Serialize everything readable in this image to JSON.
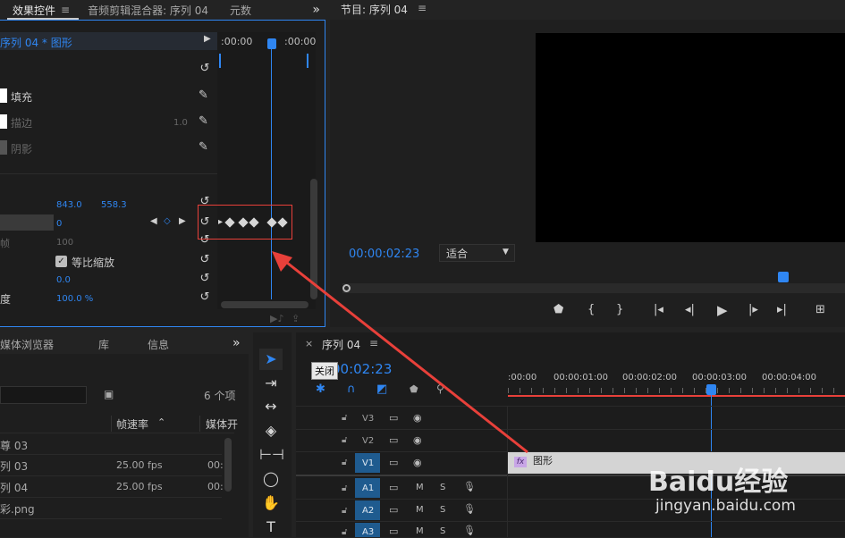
{
  "effect_controls": {
    "tabs": [
      "效果控件",
      "音频剪辑混合器: 序列 04",
      "元数"
    ],
    "overflow": "»",
    "menu_icon": "≡",
    "clip_path": "序列 04 * 图形",
    "timeline_start": ":00:00",
    "timeline_end": ":00:00",
    "appearance": {
      "fill_label": "填充",
      "stroke_label": "描边",
      "stroke_value": "1.0",
      "shadow_label": "阴影"
    },
    "position": {
      "x": "843.0",
      "y": "558.3"
    },
    "scale_value": "0",
    "scale_width_label": "帧",
    "scale_width_value": "100",
    "uniform_scale_label": "等比缩放",
    "rotation_value": "0.0",
    "opacity_label": "度",
    "opacity_value": "100.0 %"
  },
  "program": {
    "title": "节目: 序列 04",
    "menu_icon": "≡",
    "timecode": "00:00:02:23",
    "fit_label": "适合"
  },
  "project": {
    "tabs": [
      "媒体浏览器",
      "库",
      "信息"
    ],
    "overflow": "»",
    "item_count": "6 个项",
    "columns": [
      "帧速率",
      "媒体开"
    ],
    "rows": [
      {
        "name": "尊 03",
        "fps": "",
        "start": ""
      },
      {
        "name": "列 03",
        "fps": "25.00 fps",
        "start": "00:"
      },
      {
        "name": "列 04",
        "fps": "25.00 fps",
        "start": "00:"
      },
      {
        "name": "彩.png",
        "fps": "",
        "start": ""
      }
    ]
  },
  "timeline": {
    "close": "×",
    "sequence_name": "序列 04",
    "menu_icon": "≡",
    "timecode": "00:02:23",
    "tooltip": "关闭",
    "ruler": [
      ":00:00",
      "00:00:01:00",
      "00:00:02:00",
      "00:00:03:00",
      "00:00:04:00"
    ],
    "video_tracks": [
      "V3",
      "V2",
      "V1"
    ],
    "audio_tracks": [
      "A1",
      "A2",
      "A3"
    ],
    "mute_label": "M",
    "solo_label": "S",
    "clip_label": "图形",
    "fx_badge": "fx"
  },
  "watermark": {
    "brand": "Baidu经验",
    "url": "jingyan.baidu.com"
  },
  "colors": {
    "accent": "#2f86f2",
    "annotation": "#e8403a",
    "track_active": "#1f5b8f"
  }
}
